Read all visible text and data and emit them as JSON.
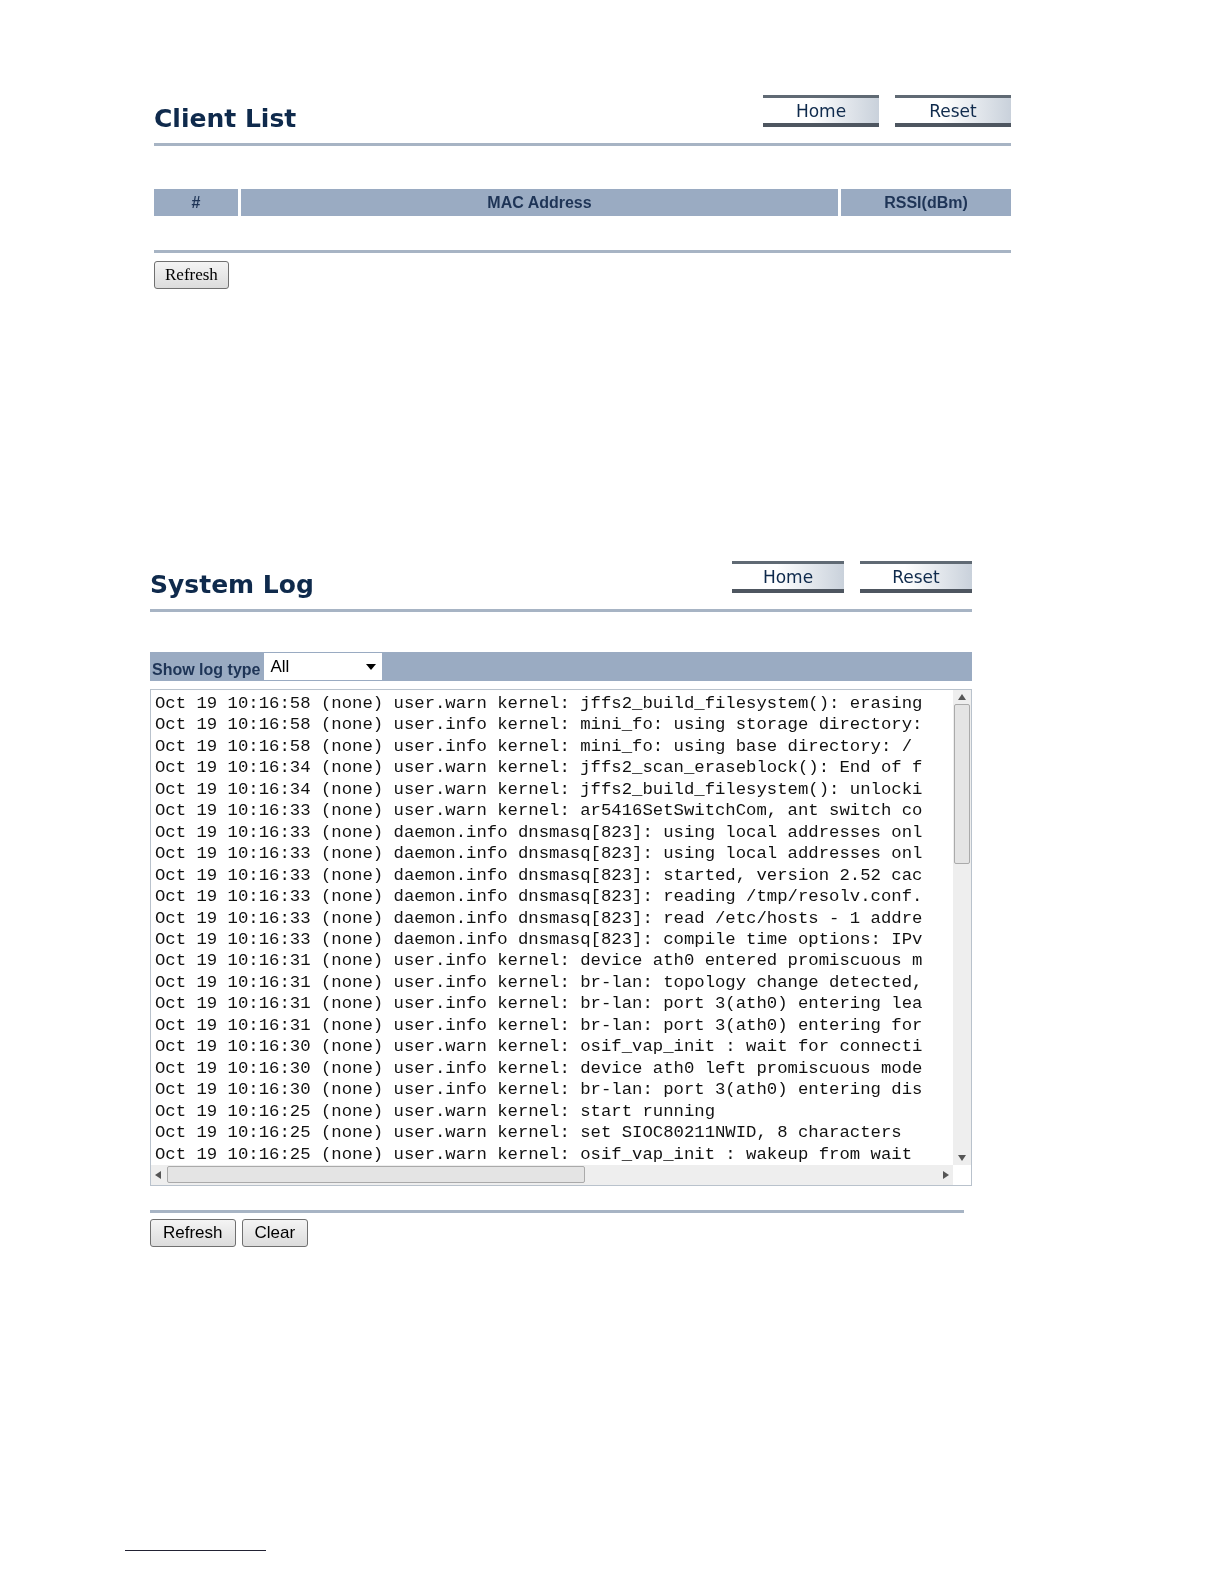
{
  "client_list": {
    "title": "Client List",
    "buttons": [
      "Home",
      "Reset"
    ],
    "table": {
      "columns": [
        "#",
        "MAC Address",
        "RSSI(dBm)"
      ]
    },
    "refresh_button": "Refresh"
  },
  "system_log": {
    "title": "System Log",
    "buttons": [
      "Home",
      "Reset"
    ],
    "filter": {
      "label": "Show log type",
      "value": "All"
    },
    "lines": [
      "Oct 19 10:16:58 (none) user.warn kernel: jffs2_build_filesystem(): erasing",
      "Oct 19 10:16:58 (none) user.info kernel: mini_fo: using storage directory:",
      "Oct 19 10:16:58 (none) user.info kernel: mini_fo: using base directory: /",
      "Oct 19 10:16:34 (none) user.warn kernel: jffs2_scan_eraseblock(): End of f",
      "Oct 19 10:16:34 (none) user.warn kernel: jffs2_build_filesystem(): unlocki",
      "Oct 19 10:16:33 (none) user.warn kernel: ar5416SetSwitchCom, ant switch co",
      "Oct 19 10:16:33 (none) daemon.info dnsmasq[823]: using local addresses onl",
      "Oct 19 10:16:33 (none) daemon.info dnsmasq[823]: using local addresses onl",
      "Oct 19 10:16:33 (none) daemon.info dnsmasq[823]: started, version 2.52 cac",
      "Oct 19 10:16:33 (none) daemon.info dnsmasq[823]: reading /tmp/resolv.conf.",
      "Oct 19 10:16:33 (none) daemon.info dnsmasq[823]: read /etc/hosts - 1 addre",
      "Oct 19 10:16:33 (none) daemon.info dnsmasq[823]: compile time options: IPv",
      "Oct 19 10:16:31 (none) user.info kernel: device ath0 entered promiscuous m",
      "Oct 19 10:16:31 (none) user.info kernel: br-lan: topology change detected,",
      "Oct 19 10:16:31 (none) user.info kernel: br-lan: port 3(ath0) entering lea",
      "Oct 19 10:16:31 (none) user.info kernel: br-lan: port 3(ath0) entering for",
      "Oct 19 10:16:30 (none) user.warn kernel: osif_vap_init : wait for connecti",
      "Oct 19 10:16:30 (none) user.info kernel: device ath0 left promiscuous mode",
      "Oct 19 10:16:30 (none) user.info kernel: br-lan: port 3(ath0) entering dis",
      "Oct 19 10:16:25 (none) user.warn kernel: start running",
      "Oct 19 10:16:25 (none) user.warn kernel: set SIOC80211NWID, 8 characters",
      "Oct 19 10:16:25 (none) user.warn kernel: osif_vap_init : wakeup from wait"
    ],
    "footer_buttons": [
      "Refresh",
      "Clear"
    ]
  }
}
